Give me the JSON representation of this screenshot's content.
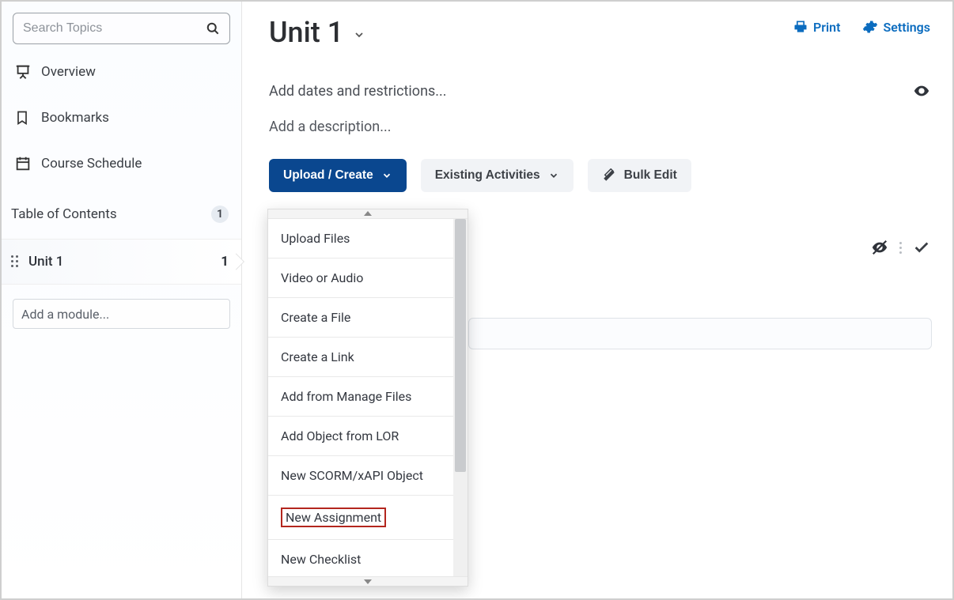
{
  "sidebar": {
    "search_placeholder": "Search Topics",
    "overview_label": "Overview",
    "bookmarks_label": "Bookmarks",
    "schedule_label": "Course Schedule",
    "toc_label": "Table of Contents",
    "toc_count": "1",
    "unit_label": "Unit 1",
    "unit_count": "1",
    "add_module_placeholder": "Add a module..."
  },
  "page": {
    "title": "Unit 1",
    "print_label": "Print",
    "settings_label": "Settings",
    "dates_link": "Add dates and restrictions...",
    "description_link": "Add a description..."
  },
  "toolbar": {
    "upload_create_label": "Upload / Create",
    "existing_activities_label": "Existing Activities",
    "bulk_edit_label": "Bulk Edit"
  },
  "dropdown": {
    "items": {
      "0": "Upload Files",
      "1": "Video or Audio",
      "2": "Create a File",
      "3": "Create a Link",
      "4": "Add from Manage Files",
      "5": "Add Object from LOR",
      "6": "New SCORM/xAPI Object",
      "7": "New Assignment",
      "8": "New Checklist"
    },
    "highlight_index": 7
  }
}
